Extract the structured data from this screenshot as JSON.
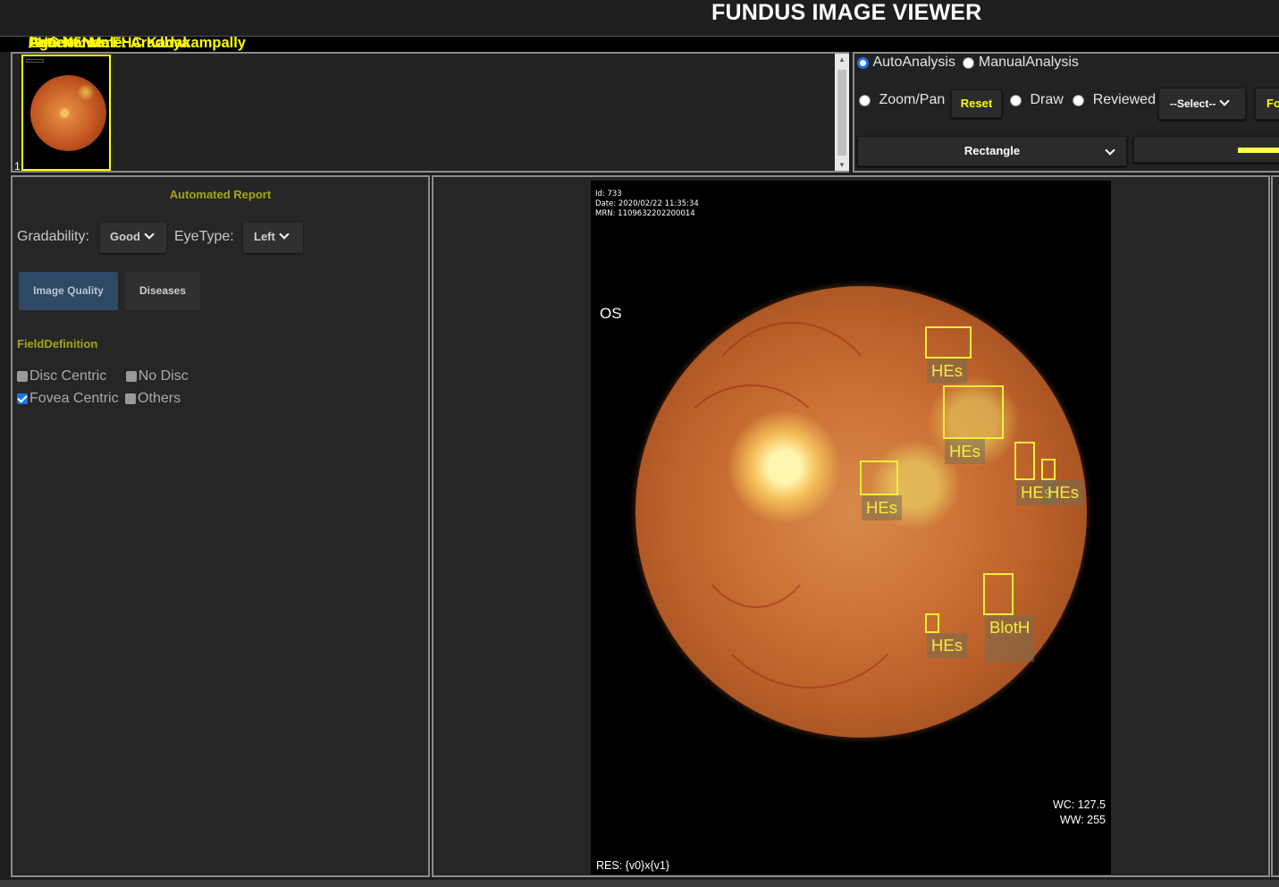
{
  "app": {
    "title": "FUNDUS IMAGE VIEWER"
  },
  "patient": {
    "name": "Patient Name: Aradhya",
    "age": "Age: 45",
    "gender": "Gender: Male",
    "fhc": "FHC Name: FHC Kadakampally",
    "separator": "/"
  },
  "thumbnails": {
    "index_label": "1"
  },
  "tools": {
    "auto_analysis": "AutoAnalysis",
    "manual_analysis": "ManualAnalysis",
    "zoom_pan": "Zoom/Pan",
    "reset": "Reset",
    "draw": "Draw",
    "reviewed": "Reviewed",
    "select": "--Select--",
    "fo_button": "Fo",
    "shape": "Rectangle",
    "selected_mode": "AutoAnalysis",
    "line_color": "#ffff4d"
  },
  "report": {
    "title": "Automated Report",
    "gradability_label": "Gradability:",
    "gradability_value": "Good",
    "eyetype_label": "EyeType:",
    "eyetype_value": "Left",
    "image_quality_button": "Image Quality",
    "diseases_button": "Diseases",
    "field_definition_label": "FieldDefinition",
    "checkboxes": [
      {
        "label": "Disc Centric",
        "checked": false
      },
      {
        "label": "No Disc",
        "checked": false
      },
      {
        "label": "Fovea Centric",
        "checked": true
      },
      {
        "label": "Others",
        "checked": false
      }
    ]
  },
  "viewer": {
    "id_line": "Id: 733",
    "date_line": "Date: 2020/02/22 11:35:34",
    "mrn_line": "MRN: 1109632202200014",
    "eye_tag": "OS",
    "wc": "WC: 127.5",
    "ww": "WW: 255",
    "res": "RES: {v0}x{v1}",
    "annotations": [
      {
        "label": "HEs"
      },
      {
        "label": "HEs"
      },
      {
        "label": "HEs"
      },
      {
        "label": "HEs"
      },
      {
        "label": "HEs"
      },
      {
        "label": "HEs"
      },
      {
        "label": "BlotH"
      }
    ],
    "annotation_color": "#f4ed3a"
  }
}
